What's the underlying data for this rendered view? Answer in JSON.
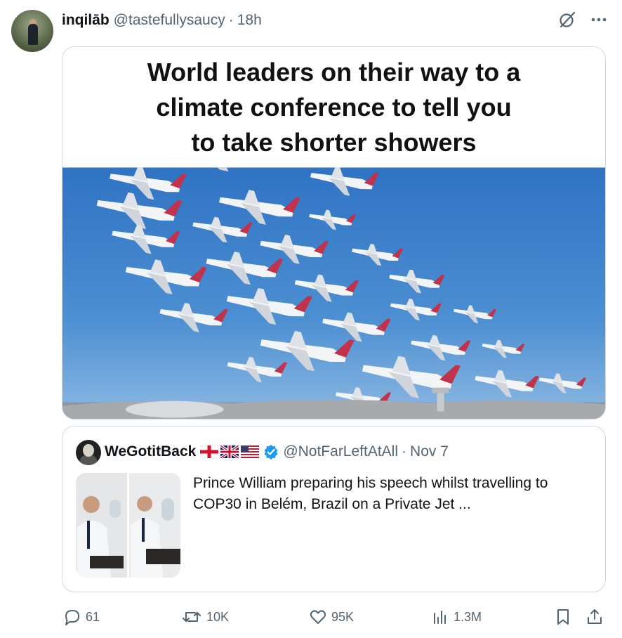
{
  "tweet": {
    "author": {
      "display_name": "inqilāb",
      "handle": "@tastefullysaucy",
      "separator": "·",
      "time": "18h"
    },
    "media": {
      "caption": "World leaders on their way to a\nclimate conference to tell you\nto take shorter showers"
    },
    "quote": {
      "display_name": "WeGotitBack",
      "flags": [
        "england-flag-icon",
        "uk-flag-icon",
        "us-flag-icon"
      ],
      "verified": true,
      "handle": "@NotFarLeftAtAll",
      "separator": "·",
      "time": "Nov 7",
      "text": "Prince William preparing his speech whilst travelling to COP30 in Belém, Brazil on a Private Jet ..."
    },
    "actions": {
      "replies": "61",
      "reposts": "10K",
      "likes": "95K",
      "views": "1.3M"
    }
  },
  "colors": {
    "text": "#0f1419",
    "secondary": "#536471",
    "border": "#cfd9de",
    "verified": "#1d9bf0",
    "sky": "#3e82c8"
  },
  "icons": [
    "grok-icon",
    "more-icon",
    "reply-icon",
    "repost-icon",
    "like-icon",
    "views-icon",
    "bookmark-icon",
    "share-icon"
  ]
}
